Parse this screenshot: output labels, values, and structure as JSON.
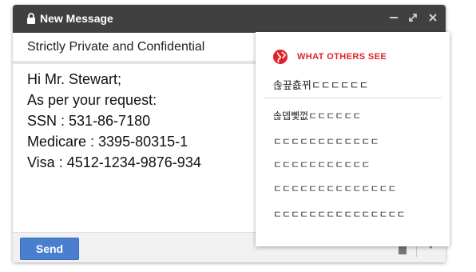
{
  "window": {
    "title": "New Message",
    "icons": [
      "lock-icon",
      "minimize-icon",
      "expand-icon",
      "close-icon"
    ]
  },
  "subject": "Strictly Private and Confidential",
  "body_lines": [
    "Hi Mr. Stewart;",
    "As per your request:",
    "SSN : 531-86-7180",
    "Medicare : 3395-80315-1",
    "Visa : 4512-1234-9876-934"
  ],
  "footer": {
    "send_label": "Send",
    "more_glyph": "▼"
  },
  "panel": {
    "title": "WHAT OTHERS SEE",
    "scrambled_subject": "솒끞춊뀌ㄷㄷㄷㄷㄷㄷ",
    "scrambled_lines": [
      "솒뎁뼻껎ㄷㄷㄷㄷㄷㄷ",
      "ㄷㄷㄷㄷㄷㄷㄷㄷㄷㄷㄷㄷ",
      "ㄷㄷㄷㄷㄷㄷㄷㄷㄷㄷㄷ",
      "ㄷㄷㄷㄷㄷㄷㄷㄷㄷㄷㄷㄷㄷㄷ",
      "ㄷㄷㄷㄷㄷㄷㄷㄷㄷㄷㄷㄷㄷㄷㄷ"
    ]
  },
  "colors": {
    "titlebar": "#404040",
    "send_button": "#4a7fd0",
    "panel_accent": "#e2222b"
  }
}
